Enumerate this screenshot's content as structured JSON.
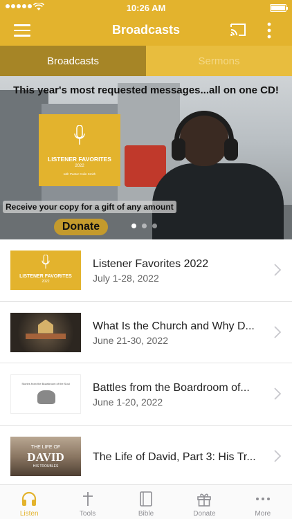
{
  "status": {
    "time": "10:26 AM"
  },
  "nav": {
    "title": "Broadcasts"
  },
  "tabs": [
    {
      "label": "Broadcasts",
      "active": true
    },
    {
      "label": "Sermons",
      "active": false
    }
  ],
  "banner": {
    "headline": "This year's most requested messages...all on one CD!",
    "album_title": "LISTENER FAVORITES",
    "album_year": "2022",
    "album_sub": "with Pastor Colin Smith",
    "caption": "Receive your copy for a gift of any amount",
    "donate_label": "Donate",
    "page_count": 3,
    "current_page": 1
  },
  "list": [
    {
      "title": "Listener Favorites 2022",
      "date": "July 1-28, 2022",
      "thumb_title": "LISTENER FAVORITES",
      "thumb_year": "2022"
    },
    {
      "title": "What Is the Church and Why D...",
      "date": "June 21-30, 2022"
    },
    {
      "title": "Battles from the Boardroom of...",
      "date": "June 1-20, 2022",
      "thumb_text": "Stories from the Boardroom of the Soul"
    },
    {
      "title": "The Life of David, Part 3: His Tr...",
      "date": "",
      "thumb_l1": "THE LIFE OF",
      "thumb_l2": "DAVID",
      "thumb_l3": "HIS TROUBLES"
    }
  ],
  "tabbar": [
    {
      "label": "Listen",
      "icon": "headphones-icon",
      "active": true
    },
    {
      "label": "Tools",
      "icon": "cross-icon",
      "active": false
    },
    {
      "label": "Bible",
      "icon": "bible-icon",
      "active": false
    },
    {
      "label": "Donate",
      "icon": "gift-icon",
      "active": false
    },
    {
      "label": "More",
      "icon": "more-dots-icon",
      "active": false
    }
  ],
  "colors": {
    "brand": "#e3b32d",
    "tab_active_bg": "#a68526",
    "inactive_tab_text": "#8e8e93"
  }
}
